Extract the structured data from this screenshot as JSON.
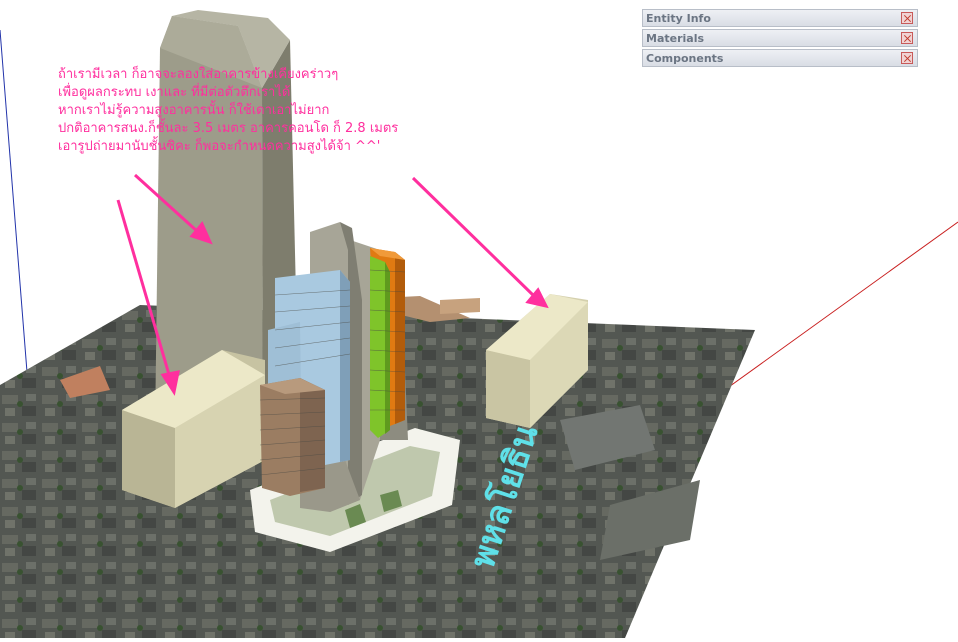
{
  "trays": [
    {
      "label": "Entity Info",
      "close_icon": "close-icon"
    },
    {
      "label": "Materials",
      "close_icon": "close-icon"
    },
    {
      "label": "Components",
      "close_icon": "close-icon"
    }
  ],
  "annotation": {
    "lines": [
      "ถ้าเรามีเวลา ก็อาจจะลองใส่อาคารข้างเคียงคร่าวๆ",
      "เพื่อดูผลกระทบ เงาและ ที่มีต่อตัวตึกเราได้",
      "หากเราไม่รู้ความสูงอาคารนั้น ก็ใช้เดาเอาไม่ยาก",
      "ปกติอาคารสนง.ก็ชั้นละ 3.5 เมตร อาคารคอนโด ก็ 2.8 เมตร",
      "เอารูปถ่ายมานับชั้นซิคะ ก็พอจะกำหนดความสูงได้จ้า ^^'"
    ],
    "color": "#ff2f9e"
  },
  "map_text": "พหลโยธิน",
  "colors": {
    "axis_blue": "#2233aa",
    "axis_red": "#c81e1e",
    "box_face": "#ece8c8",
    "tower_face": "#9d9c8a",
    "ground": "#5a5e58",
    "apartment_blue": "#a9c9e0",
    "apartment_green": "#7fc42a",
    "apartment_orange": "#e07a12",
    "apartment_brown": "#9b7d62"
  }
}
